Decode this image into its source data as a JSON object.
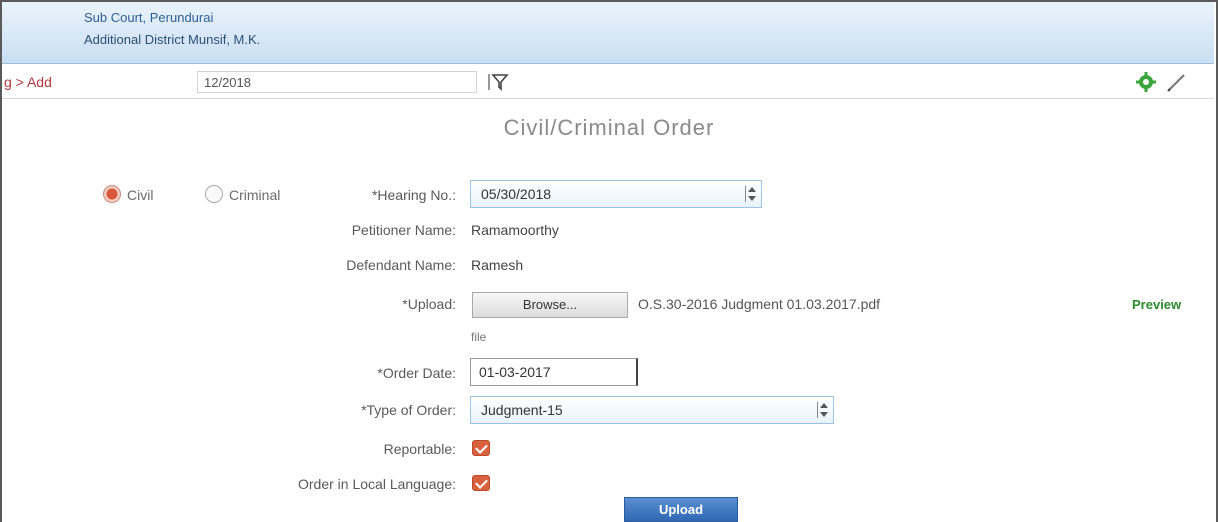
{
  "header": {
    "org": "Sub Court, Perundurai",
    "subtitle": "Additional District Munsif, M.K."
  },
  "toolbar": {
    "crumb": "g > Add",
    "case_number": "12/2018",
    "filter_icon": "filter-icon",
    "settings_icon": "gear-icon",
    "edit_icon": "pencil-icon",
    "icon_color_settings": "#3aa53a"
  },
  "form": {
    "title": "Civil/Criminal Order",
    "radio_civil": "Civil",
    "radio_criminal": "Criminal",
    "hearing_label": "*Hearing No.:",
    "hearing_value": "05/30/2018",
    "petitioner_label": "Petitioner Name:",
    "petitioner_value": "Ramamoorthy",
    "defendant_label": "Defendant Name:",
    "defendant_value": "Ramesh",
    "upload_label": "*Upload:",
    "browse_label": "Browse...",
    "file_name": "O.S.30-2016 Judgment 01.03.2017.pdf",
    "preview_label": "Preview",
    "file_suffix": "file",
    "order_date_label": "*Order Date:",
    "order_date_value": "01-03-2017",
    "order_type_label": "*Type of Order:",
    "order_type_value": "Judgment-15",
    "reportable_label": "Reportable:",
    "local_lang_label": "Order in Local Language:",
    "upload_button": "Upload"
  }
}
